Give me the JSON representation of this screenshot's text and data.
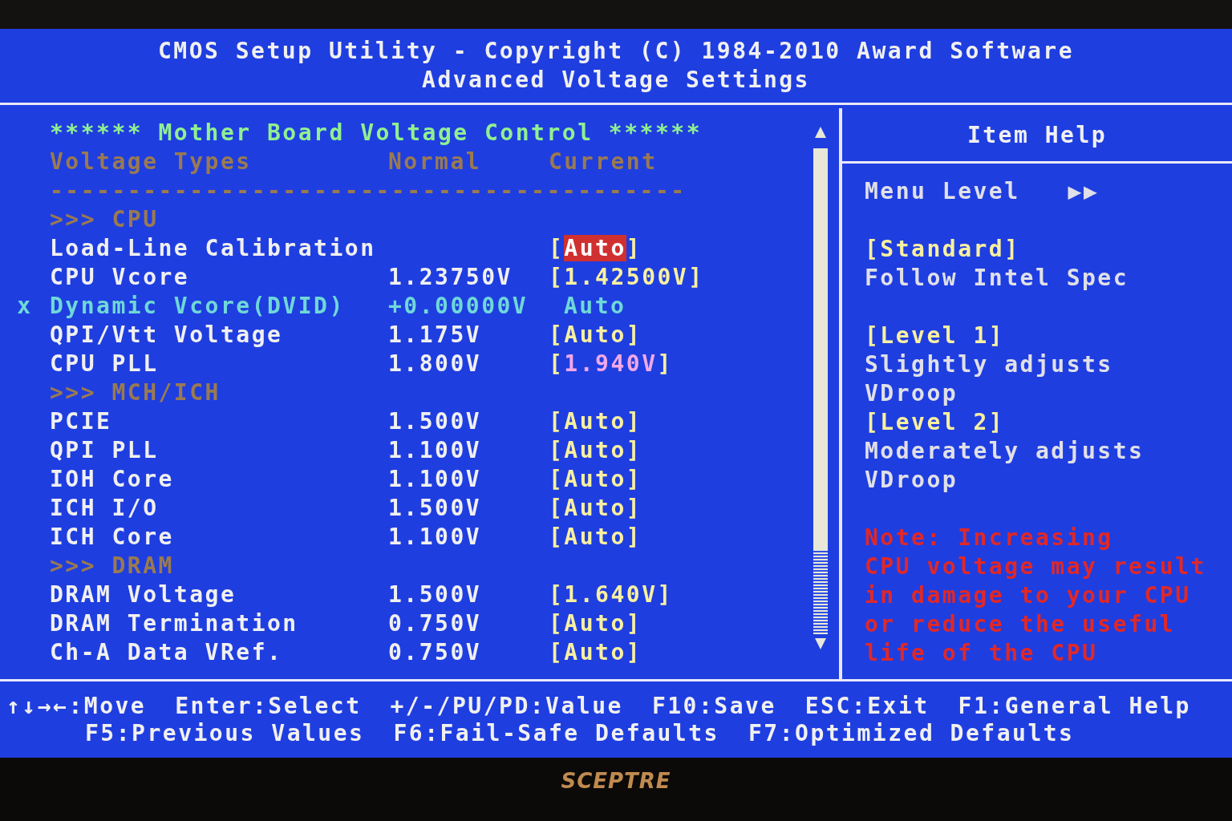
{
  "header": {
    "title": "CMOS Setup Utility - Copyright (C) 1984-2010 Award Software",
    "subtitle": "Advanced Voltage Settings"
  },
  "panel": {
    "title": "****** Mother Board Voltage Control ******",
    "columns": [
      "Voltage Types",
      "Normal",
      "Current"
    ],
    "divider": "-----------------------------------------",
    "rows": [
      {
        "kind": "section",
        "label": ">>> CPU"
      },
      {
        "kind": "item",
        "name": "Load-Line Calibration",
        "open": "[",
        "current": "Auto",
        "close": "]",
        "selected": true,
        "disabled": false
      },
      {
        "kind": "item",
        "name": "CPU Vcore",
        "normal": "1.23750V",
        "open": "[",
        "current": "1.42500V",
        "close": "]",
        "selected": false,
        "disabled": false,
        "color": "#f8f0a0"
      },
      {
        "kind": "item",
        "marker": "x",
        "name": "Dynamic Vcore(DVID)",
        "normal": "+0.00000V",
        "current": "Auto",
        "selected": false,
        "disabled": true,
        "color": "#6fd8d8"
      },
      {
        "kind": "item",
        "name": "QPI/Vtt Voltage",
        "normal": "1.175V",
        "open": "[",
        "current": "Auto",
        "close": "]",
        "selected": false,
        "disabled": false,
        "color": "#f8f0a0"
      },
      {
        "kind": "item",
        "name": "CPU PLL",
        "normal": "1.800V",
        "open": "[",
        "current": "1.940V",
        "close": "]",
        "selected": false,
        "disabled": false,
        "color": "#f0a8e8"
      },
      {
        "kind": "section",
        "label": ">>> MCH/ICH"
      },
      {
        "kind": "item",
        "name": "PCIE",
        "normal": "1.500V",
        "open": "[",
        "current": "Auto",
        "close": "]",
        "selected": false,
        "disabled": false,
        "color": "#f8f0a0"
      },
      {
        "kind": "item",
        "name": "QPI PLL",
        "normal": "1.100V",
        "open": "[",
        "current": "Auto",
        "close": "]",
        "selected": false,
        "disabled": false,
        "color": "#f8f0a0"
      },
      {
        "kind": "item",
        "name": "IOH Core",
        "normal": "1.100V",
        "open": "[",
        "current": "Auto",
        "close": "]",
        "selected": false,
        "disabled": false,
        "color": "#f8f0a0"
      },
      {
        "kind": "item",
        "name": "ICH I/O",
        "normal": "1.500V",
        "open": "[",
        "current": "Auto",
        "close": "]",
        "selected": false,
        "disabled": false,
        "color": "#f8f0a0"
      },
      {
        "kind": "item",
        "name": "ICH Core",
        "normal": "1.100V",
        "open": "[",
        "current": "Auto",
        "close": "]",
        "selected": false,
        "disabled": false,
        "color": "#f8f0a0"
      },
      {
        "kind": "section",
        "label": ">>> DRAM"
      },
      {
        "kind": "item",
        "name": "DRAM Voltage",
        "normal": "1.500V",
        "open": "[",
        "current": "1.640V",
        "close": "]",
        "selected": false,
        "disabled": false,
        "color": "#f8f0a0"
      },
      {
        "kind": "item",
        "name": "DRAM Termination",
        "normal": "0.750V",
        "open": "[",
        "current": "Auto",
        "close": "]",
        "selected": false,
        "disabled": false,
        "color": "#f8f0a0"
      },
      {
        "kind": "item",
        "name": "Ch-A Data VRef.",
        "normal": "0.750V",
        "open": "[",
        "current": "Auto",
        "close": "]",
        "selected": false,
        "disabled": false,
        "color": "#f8f0a0"
      }
    ]
  },
  "help": {
    "title": "Item Help",
    "menu_level": "Menu Level",
    "menu_level_mark": "▶▶",
    "lines": [
      {
        "kind": "gap"
      },
      {
        "kind": "option",
        "text": "[Standard]"
      },
      {
        "kind": "text",
        "text": "Follow Intel Spec"
      },
      {
        "kind": "gap"
      },
      {
        "kind": "option",
        "text": "[Level 1]"
      },
      {
        "kind": "text",
        "text": "Slightly adjusts"
      },
      {
        "kind": "text",
        "text": "VDroop"
      },
      {
        "kind": "option",
        "text": "[Level 2]"
      },
      {
        "kind": "text",
        "text": "Moderately adjusts"
      },
      {
        "kind": "text",
        "text": "VDroop"
      },
      {
        "kind": "gap"
      },
      {
        "kind": "note",
        "text": "Note: Increasing"
      },
      {
        "kind": "note",
        "text": "CPU voltage may result"
      },
      {
        "kind": "note",
        "text": "in damage to your CPU"
      },
      {
        "kind": "note",
        "text": "or reduce the useful"
      },
      {
        "kind": "note",
        "text": "life of the CPU"
      }
    ]
  },
  "footer": [
    [
      "↑↓→←:Move",
      "Enter:Select",
      "+/-/PU/PD:Value",
      "F10:Save",
      "ESC:Exit",
      "F1:General Help"
    ],
    [
      "F5:Previous Values",
      "F6:Fail-Safe Defaults",
      "F7:Optimized Defaults"
    ]
  ],
  "bezel": {
    "logo": "SCEPTRE"
  }
}
